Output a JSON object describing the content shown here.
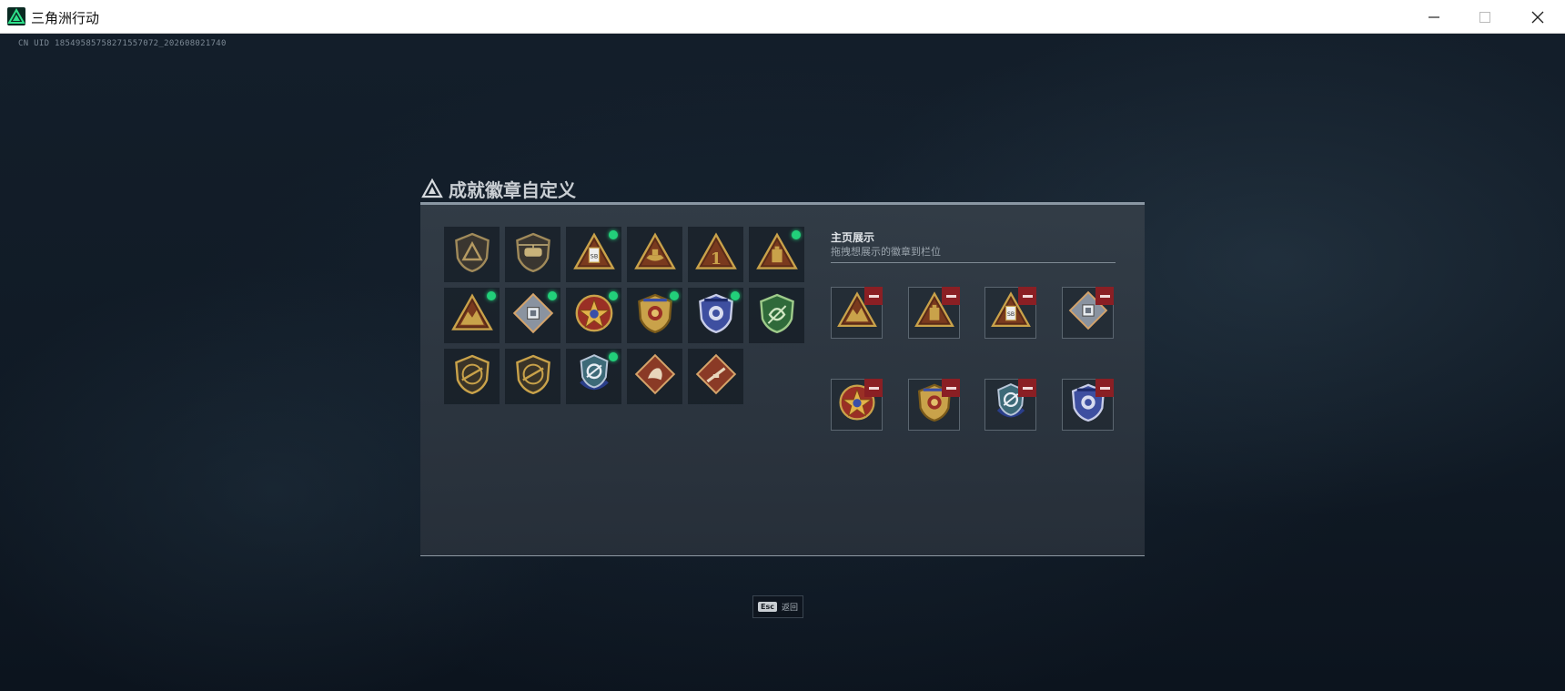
{
  "window": {
    "title": "三角洲行动",
    "controls": [
      "minimize-icon",
      "maximize-icon",
      "close-icon"
    ]
  },
  "game": {
    "uid": "CN UID 18549585758271557072_202608021740",
    "panel_title": "成就徽章自定义",
    "showcase": {
      "title": "主页展示",
      "subtitle": "拖拽想展示的徽章到栏位"
    },
    "esc_hint": {
      "key": "Esc",
      "label": "返回"
    }
  },
  "badges": [
    {
      "icon": "delta-shield-badge",
      "new": false
    },
    {
      "icon": "helicopter-badge",
      "new": false
    },
    {
      "icon": "sb-canister-triangle-badge",
      "new": true
    },
    {
      "icon": "boat-triangle-badge",
      "new": false
    },
    {
      "icon": "number-one-triangle-badge",
      "new": false
    },
    {
      "icon": "canister-triangle-badge",
      "new": true
    },
    {
      "icon": "mountain-triangle-badge",
      "new": true
    },
    {
      "icon": "data-chip-badge",
      "new": true
    },
    {
      "icon": "star-medal-badge",
      "new": true
    },
    {
      "icon": "police-shield-gold-badge",
      "new": true
    },
    {
      "icon": "police-shield-blue-badge",
      "new": true
    },
    {
      "icon": "green-shield-badge",
      "new": false
    },
    {
      "icon": "rifle-shield-badge",
      "new": false
    },
    {
      "icon": "rifle-shield-badge-2",
      "new": false
    },
    {
      "icon": "blue-crest-badge",
      "new": true
    },
    {
      "icon": "eagle-diamond-badge",
      "new": false
    },
    {
      "icon": "weapon-diamond-badge",
      "new": false
    }
  ],
  "showcase_slots": [
    {
      "icon": "mountain-triangle-badge"
    },
    {
      "icon": "canister-triangle-badge"
    },
    {
      "icon": "sb-canister-triangle-badge"
    },
    {
      "icon": "data-chip-badge"
    },
    {
      "icon": "star-medal-badge"
    },
    {
      "icon": "police-shield-gold-badge"
    },
    {
      "icon": "blue-crest-badge"
    },
    {
      "icon": "police-shield-blue-badge"
    }
  ],
  "colors": {
    "accent_green": "#22d07a",
    "remove_red": "#8a1f24",
    "gold": "#c9a24a",
    "badge_blue": "#3a4fa8"
  }
}
